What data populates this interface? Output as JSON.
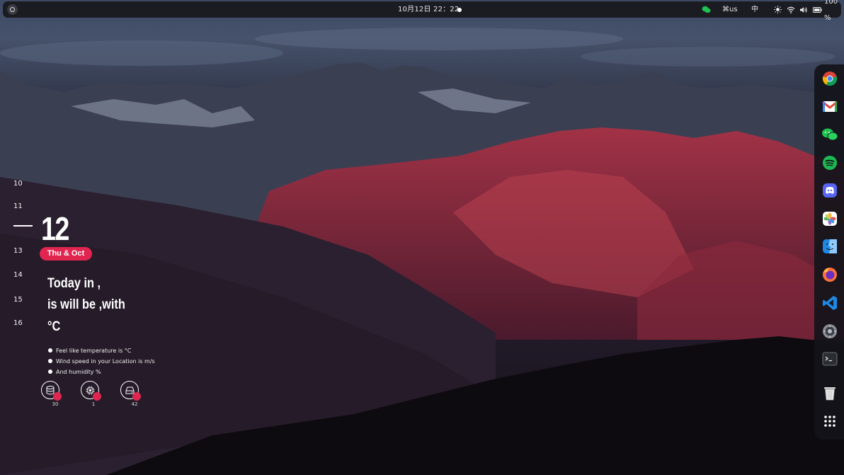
{
  "topbar": {
    "clock": "10月12日  22：22",
    "keyboard_layout": "⌘us",
    "input_method": "中",
    "battery": "100 %"
  },
  "calendar": {
    "days_before": [
      "10",
      "11"
    ],
    "current_day": "12",
    "days_after": [
      "13",
      "14",
      "15",
      "16"
    ],
    "date_label": "Thu & Oct"
  },
  "weather": {
    "line1": "Today in ,",
    "line2": "is will be ,with",
    "line3": "°C",
    "details": [
      "Feel like temperature is °C",
      "Wind speed in your Location is  m/s",
      "And humidity %"
    ]
  },
  "gauges": [
    {
      "icon": "database-icon",
      "value": "30"
    },
    {
      "icon": "cpu-icon",
      "value": "1"
    },
    {
      "icon": "hard-drive-icon",
      "value": "42"
    }
  ],
  "dock": {
    "apps": [
      "chrome",
      "gmail",
      "wechat",
      "spotify",
      "discord",
      "photos",
      "finder",
      "firefox",
      "vscode",
      "settings",
      "terminal",
      "trash",
      "app-grid"
    ]
  },
  "colors": {
    "accent": "#e02650",
    "topbar_bg": "#1b1c22"
  }
}
